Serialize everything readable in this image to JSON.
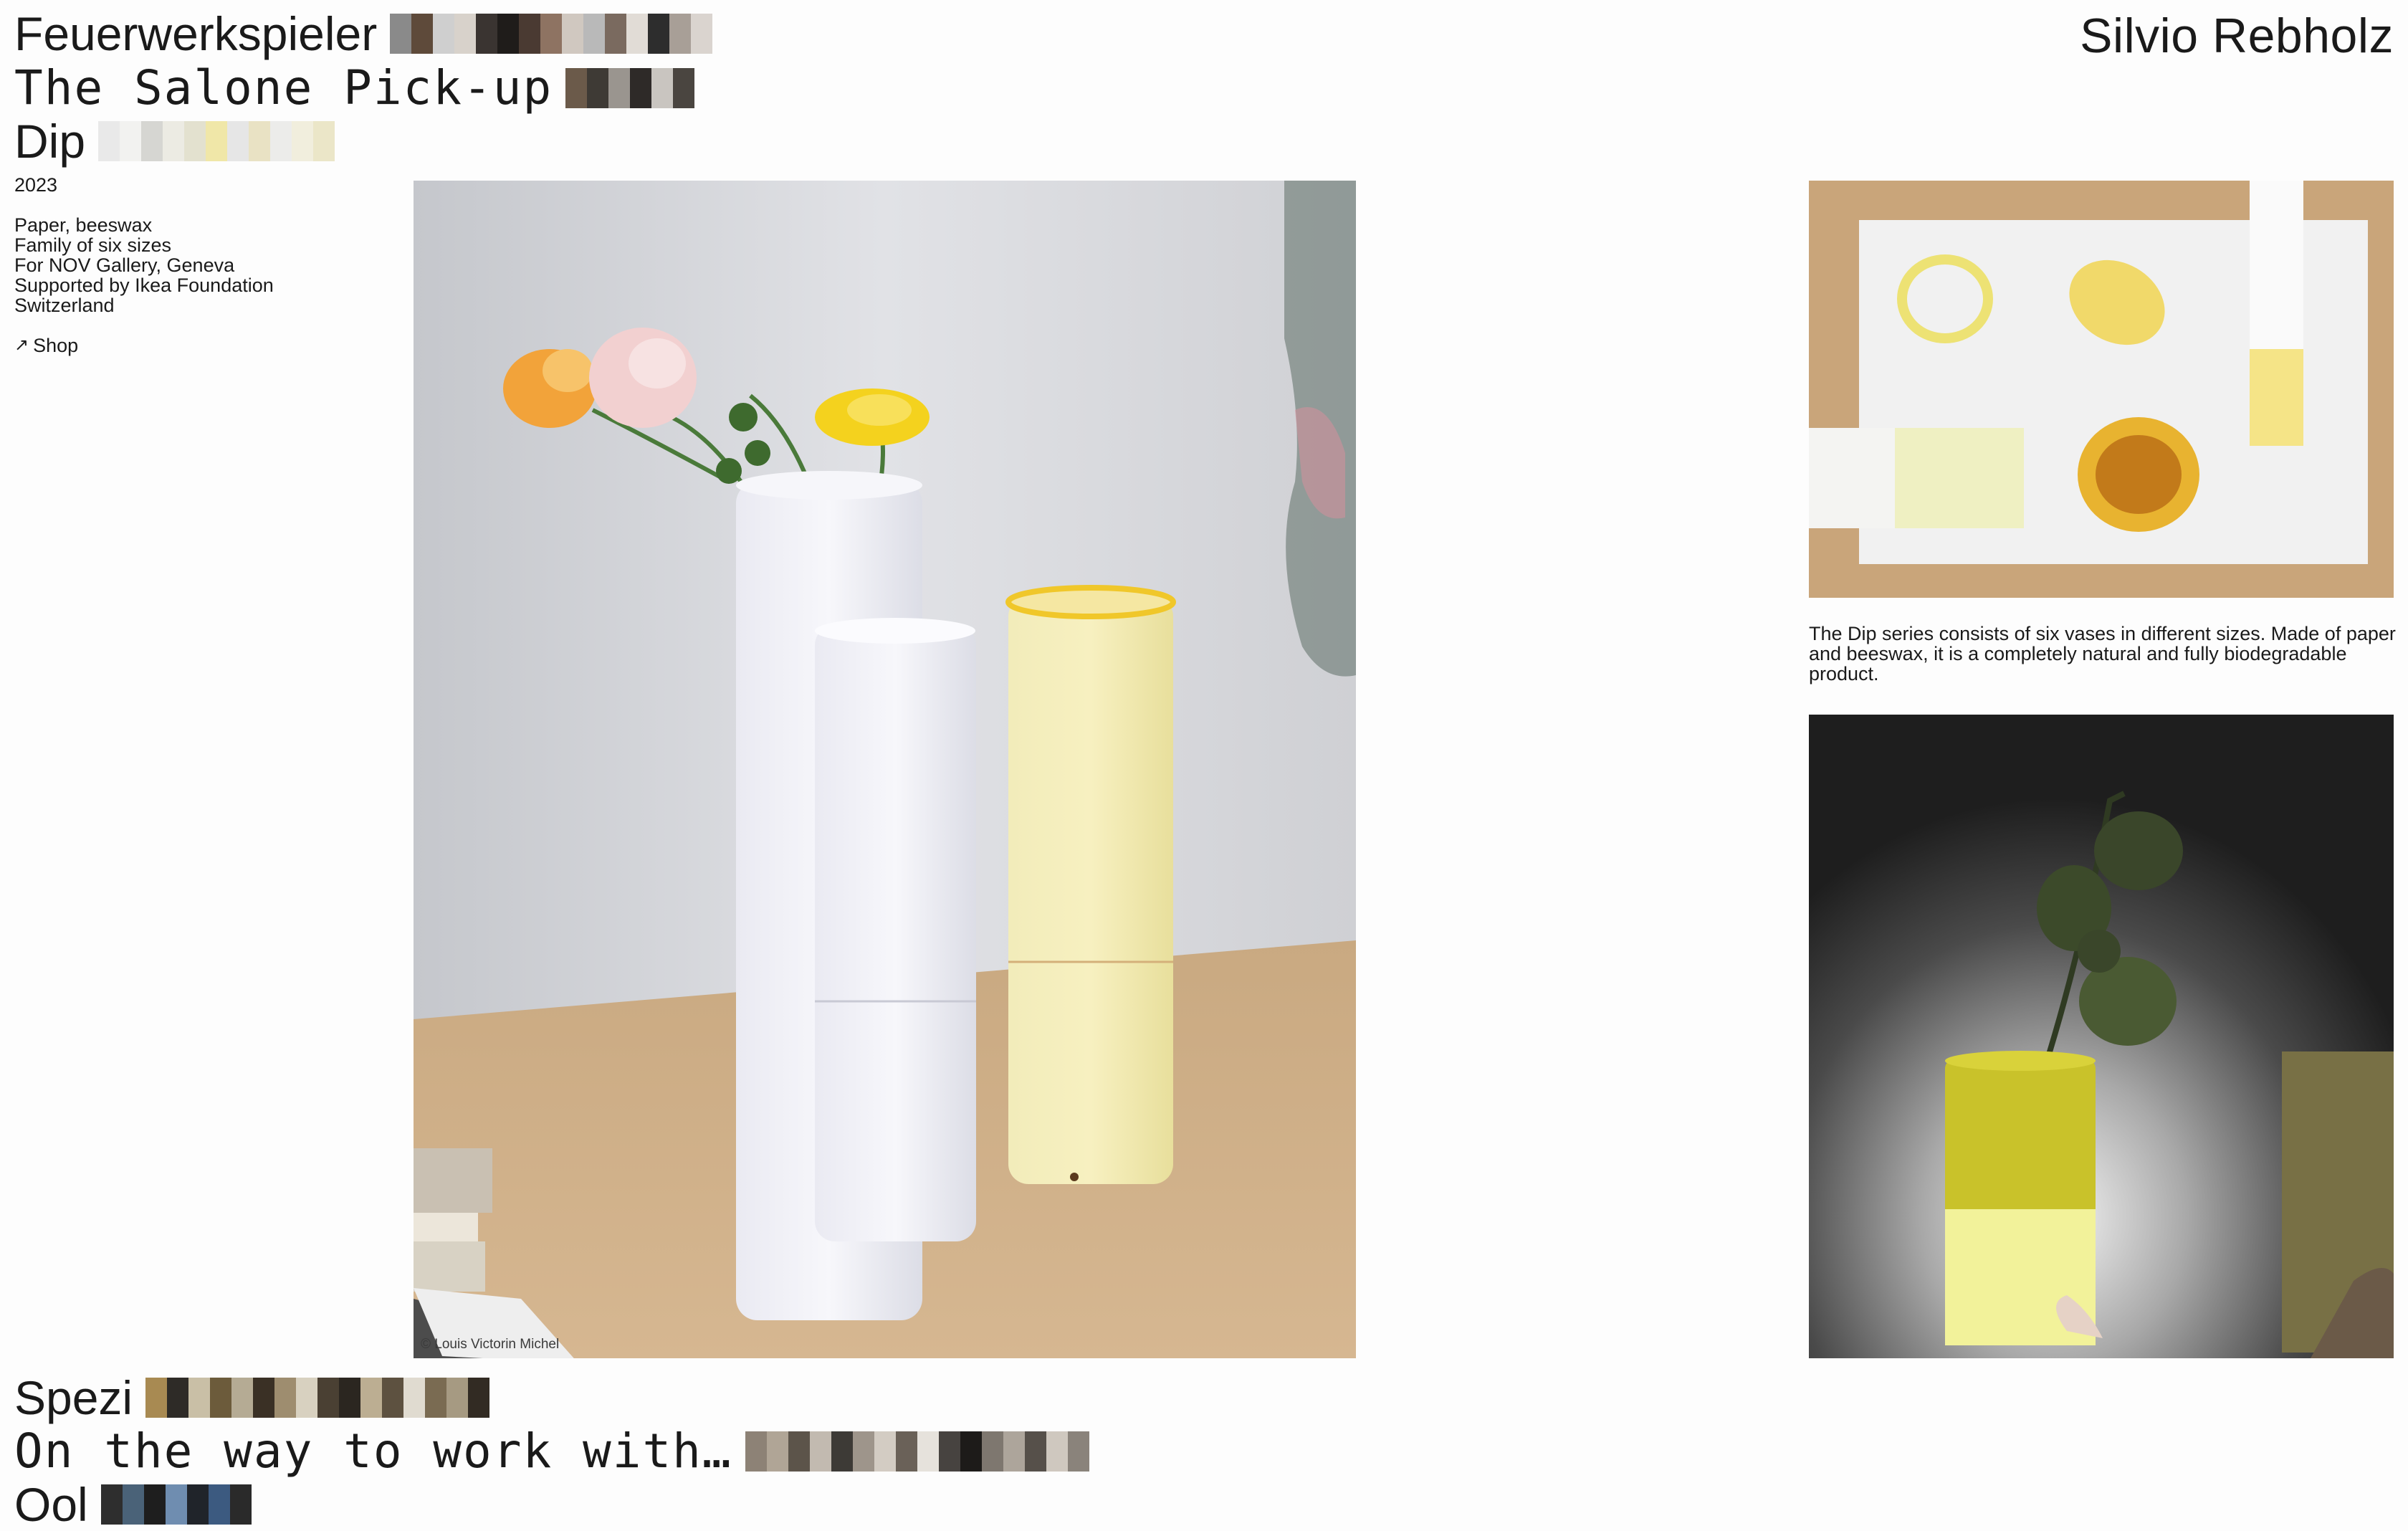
{
  "site": {
    "brand": "Silvio Rebholz"
  },
  "projects": [
    {
      "title": "Feuerwerkspieler",
      "thumbs": [
        "#8a8a8a",
        "#5e4a3a",
        "#cfcfcf",
        "#d8d2cb",
        "#3a3431",
        "#1f1c1a",
        "#4a3a32",
        "#8e7362",
        "#d0c8c0",
        "#b9b9b9",
        "#7a6a5f",
        "#e1dcd6",
        "#2d2d2d",
        "#a89f97",
        "#dad4cf"
      ]
    },
    {
      "title": "The Salone Pick-up",
      "thumbs": [
        "#6b5a4a",
        "#3e3a35",
        "#9a958f",
        "#2e2a28",
        "#c9c5c0",
        "#4a4540"
      ]
    },
    {
      "title": "Dip",
      "thumbs": [
        "#e9e9e9",
        "#f2f2f0",
        "#d6d6d2",
        "#ecebe3",
        "#e3e1cf",
        "#f0e7a8",
        "#e6e6e6",
        "#e9e2c4",
        "#ececea",
        "#f1eedd",
        "#ebe6c8"
      ]
    },
    {
      "title": "Spezi",
      "thumbs": [
        "#a88a52",
        "#2e2b27",
        "#c9bfa6",
        "#6c5b3b",
        "#b5ab94",
        "#3a3025",
        "#9e8d6f",
        "#d8d1c0",
        "#4a4033",
        "#2b2620",
        "#bcae92",
        "#5d5140",
        "#e0dbd0",
        "#7a6b52",
        "#a69a82",
        "#322b23"
      ]
    },
    {
      "title": "On the way to work with…",
      "thumbs": [
        "#8d8276",
        "#b0a596",
        "#5c544a",
        "#c2bab0",
        "#3d3a36",
        "#9e958b",
        "#d3ccc3",
        "#6a6158",
        "#e6e2dc",
        "#474340",
        "#1d1b19",
        "#7e776f",
        "#ada59b",
        "#56504a",
        "#cfc8bf",
        "#8a837b"
      ]
    },
    {
      "title": "Ool",
      "thumbs": [
        "#2e2e2e",
        "#4a6278",
        "#1e1e1e",
        "#6f8db0",
        "#20242a",
        "#3c5a80",
        "#2a2a2a"
      ]
    }
  ],
  "detail": {
    "year": "2023",
    "specs": [
      "Paper, beeswax",
      "Family of six sizes",
      "For NOV Gallery, Geneva",
      "Supported by Ikea Foundation",
      "Switzerland"
    ],
    "shop_label": "Shop",
    "shop_icon": "arrow-up-right-icon"
  },
  "images": {
    "main_credit": "© Louis Victorin Michel",
    "caption": "The Dip series consists of six vases in different sizes. Made of paper and beeswax, it is a completely natural and fully biodegradable product."
  }
}
